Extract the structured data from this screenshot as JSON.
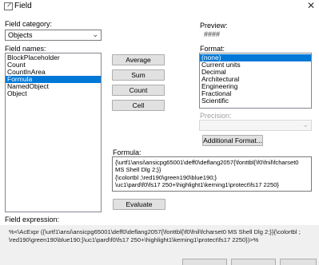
{
  "window": {
    "title": "Field",
    "close_glyph": "✕"
  },
  "category": {
    "label": "Field category:",
    "value": "Objects"
  },
  "names": {
    "label": "Field names:",
    "items": [
      "BlockPlaceholder",
      "Count",
      "CountInArea",
      "Formula",
      "NamedObject",
      "Object"
    ],
    "selected_index": 3
  },
  "buttons": {
    "average": "Average",
    "sum": "Sum",
    "count": "Count",
    "cell": "Cell",
    "evaluate": "Evaluate",
    "additional_format": "Additional Format..."
  },
  "preview": {
    "label": "Preview:",
    "value": "####"
  },
  "format": {
    "label": "Format:",
    "items": [
      "(none)",
      "Current units",
      "Decimal",
      "Architectural",
      "Engineering",
      "Fractional",
      "Scientific"
    ],
    "selected_index": 0
  },
  "precision": {
    "label": "Precision:",
    "value": ""
  },
  "formula": {
    "label": "Formula:",
    "lines": [
      "{\\urtf1\\ansi\\ansicpg65001\\deff0\\deflang2057{\\fonttbl{\\f0\\fnil\\fcharset0",
      "MS Shell Dlg 2;}}",
      "{\\colortbl ;\\red190\\green190\\blue190;}",
      "\\uc1\\pard\\f0\\fs17 250+\\highlight1\\kerning1\\protect\\fs17 2250}"
    ]
  },
  "expression": {
    "label": "Field expression:",
    "lines": [
      "%<\\AcExpr ({\\urtf1\\ansi\\ansicpg65001\\deff0\\deflang2057{\\fonttbl{\\f0\\fnil\\fcharset0 MS Shell Dlg 2;}}{\\colortbl ;",
      "\\red190\\green190\\blue190;}\\uc1\\pard\\f0\\fs17 250+\\highlight1\\kerning1\\protect\\fs17 2250})>%"
    ]
  }
}
